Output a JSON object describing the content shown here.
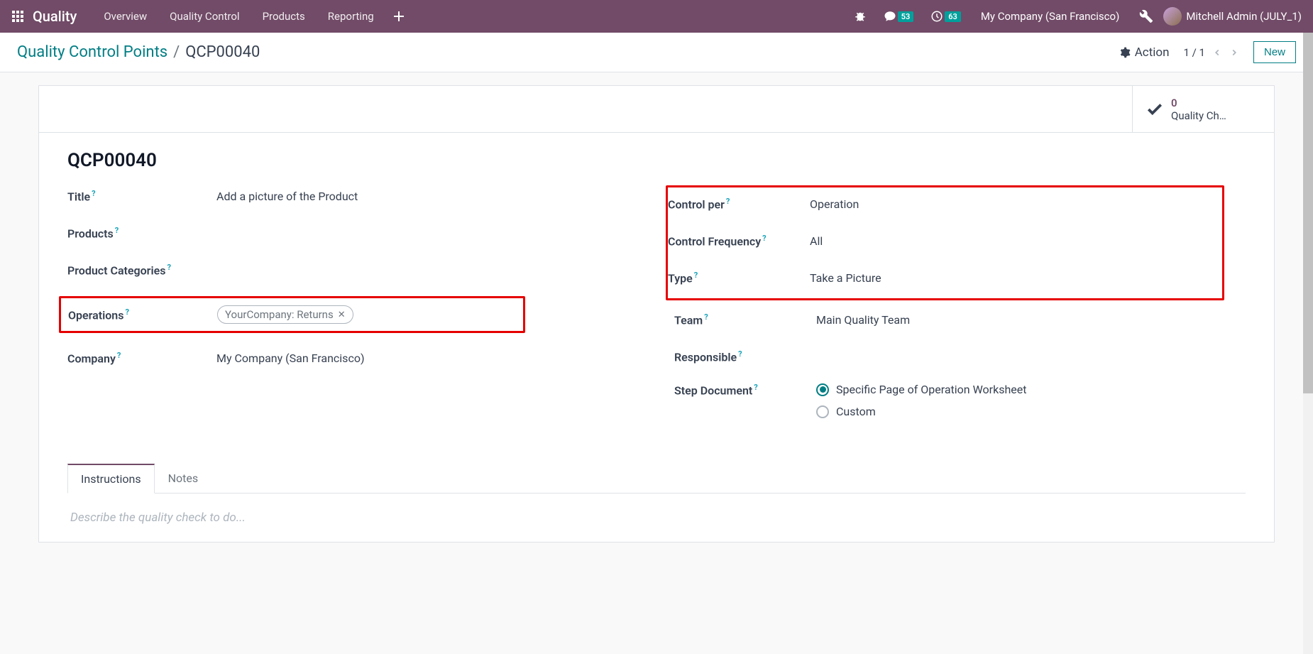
{
  "navbar": {
    "brand": "Quality",
    "items": [
      "Overview",
      "Quality Control",
      "Products",
      "Reporting"
    ],
    "messages_count": "53",
    "activities_count": "63",
    "company": "My Company (San Francisco)",
    "user": "Mitchell Admin (JULY_1)"
  },
  "breadcrumb": {
    "parent": "Quality Control Points",
    "current": "QCP00040",
    "action_label": "Action",
    "pager": "1 / 1",
    "new_label": "New"
  },
  "stat": {
    "count": "0",
    "label": "Quality Ch…"
  },
  "record": {
    "name": "QCP00040",
    "left": {
      "title_label": "Title",
      "title_value": "Add a picture of the Product",
      "products_label": "Products",
      "categories_label": "Product Categories",
      "operations_label": "Operations",
      "operations_tag": "YourCompany: Returns",
      "company_label": "Company",
      "company_value": "My Company (San Francisco)"
    },
    "right": {
      "control_per_label": "Control per",
      "control_per_value": "Operation",
      "frequency_label": "Control Frequency",
      "frequency_value": "All",
      "type_label": "Type",
      "type_value": "Take a Picture",
      "team_label": "Team",
      "team_value": "Main Quality Team",
      "responsible_label": "Responsible",
      "step_doc_label": "Step Document",
      "step_doc_opt1": "Specific Page of Operation Worksheet",
      "step_doc_opt2": "Custom"
    }
  },
  "tabs": {
    "instructions": "Instructions",
    "notes": "Notes",
    "placeholder": "Describe the quality check to do..."
  }
}
